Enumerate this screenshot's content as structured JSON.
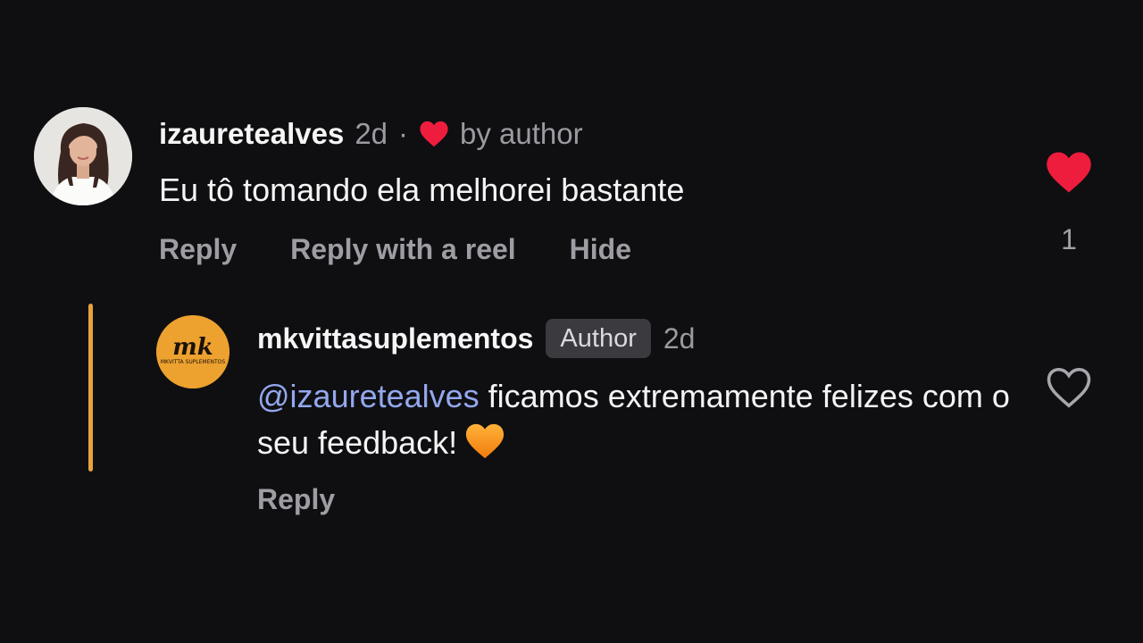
{
  "comment": {
    "username": "izauretealves",
    "time": "2d",
    "separator": "·",
    "liked_by_author_label": "by author",
    "text": "Eu tô tomando ela melhorei bastante",
    "actions": {
      "reply": "Reply",
      "reply_with_reel": "Reply with a reel",
      "hide": "Hide"
    },
    "like_count": "1",
    "liked": true
  },
  "reply": {
    "username": "mkvittasuplementos",
    "author_badge": "Author",
    "time": "2d",
    "mention": "@izauretealves",
    "text": " ficamos extremamente felizes com o seu feedback!",
    "emoji": "orange-heart-emoji",
    "actions": {
      "reply": "Reply"
    },
    "liked": false,
    "avatar_logo_text": "mk",
    "avatar_logo_subtext": "MKVITTA SUPLEMENTOS"
  },
  "colors": {
    "background": "#0f0f12",
    "like_red": "#ee1d3d",
    "mention_blue": "#93a8ee",
    "thread_line": "#e8a23c",
    "brand_orange": "#eda12f"
  }
}
